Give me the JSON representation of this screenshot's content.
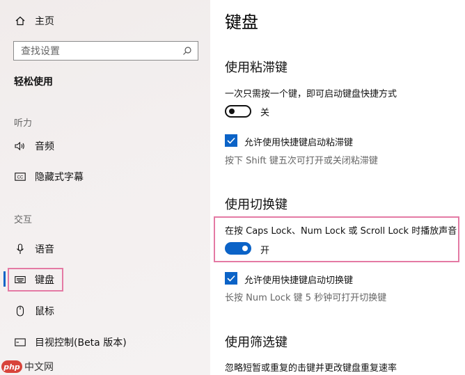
{
  "sidebar": {
    "home_label": "主页",
    "search_placeholder": "查找设置",
    "section_title": "轻松使用",
    "groups": {
      "hearing": "听力",
      "interaction": "交互"
    },
    "items": {
      "audio": "音频",
      "captions": "隐藏式字幕",
      "speech": "语音",
      "keyboard": "键盘",
      "mouse": "鼠标",
      "eye_control": "目视控制(Beta 版本)"
    }
  },
  "main": {
    "title": "键盘",
    "sticky_keys": {
      "heading": "使用粘滞键",
      "description": "一次只需按一个键，即可启动键盘快捷方式",
      "toggle_state": "关",
      "checkbox_label": "允许使用快捷键启动粘滞键",
      "hint": "按下 Shift 键五次可打开或关闭粘滞键"
    },
    "toggle_keys": {
      "heading": "使用切换键",
      "description": "在按 Caps Lock、Num Lock 或 Scroll Lock 时播放声音",
      "toggle_state": "开",
      "checkbox_label": "允许使用快捷键启动切换键",
      "hint": "长按 Num Lock 键 5 秒钟可打开切换键"
    },
    "filter_keys": {
      "heading": "使用筛选键",
      "description": "忽略短暂或重复的击键并更改键盘重复速率"
    }
  },
  "watermark": {
    "badge": "php",
    "text": "中文网"
  },
  "colors": {
    "accent": "#0b63c7",
    "highlight": "#e47aa4",
    "sidebar_bg": "#f3efef"
  }
}
